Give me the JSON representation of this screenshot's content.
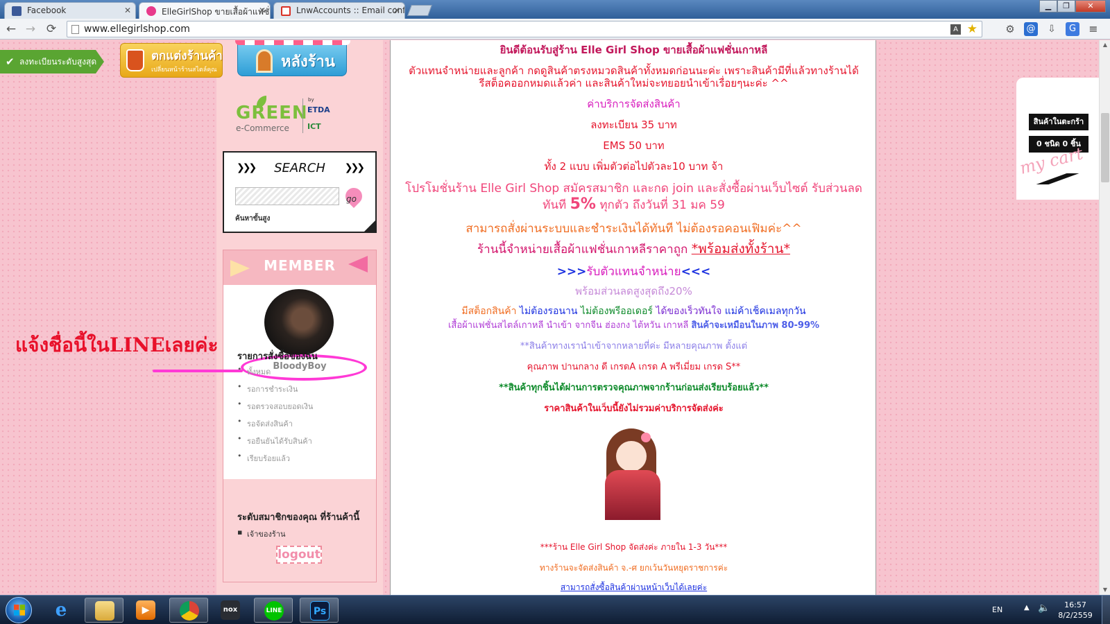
{
  "browser": {
    "tabs": [
      {
        "title": "Facebook",
        "favicon_color": "#3b5998",
        "active": false
      },
      {
        "title": "ElleGirlShop ขายเสื้อผ้าแฟชั่",
        "favicon_color": "#e83a8b",
        "active": true
      },
      {
        "title": "LnwAccounts :: Email conf",
        "favicon_color": "#d93025",
        "active": false
      }
    ],
    "url": "www.ellegirlshop.com",
    "nav": {
      "back": "←",
      "forward": "→",
      "reload": "⟳"
    }
  },
  "header_strip": {
    "level_badge": "ลงทะเบียนระดับสูงสุด",
    "decorate_button": {
      "title": "ตกแต่งร้านค้า",
      "subtitle": "เปลี่ยนหน้าร้านสไตล์คุณ"
    },
    "backstore_button": "หลังร้าน"
  },
  "green_logo": {
    "brand": "GREEN",
    "sub": "e-Commerce",
    "by": "by",
    "org1": "ETDA",
    "org2": "ICT"
  },
  "search": {
    "title": "SEARCH",
    "placeholder": "",
    "go_label": "go",
    "advanced_label": "ค้นหาขั้นสูง"
  },
  "member": {
    "title": "MEMBER",
    "username": "BloodyBoy",
    "orders_heading": "รายการสั่งซื้อของฉัน",
    "orders": [
      "ทั้งหมด",
      "รอการชำระเงิน",
      "รอตรวจสอบยอดเงิน",
      "รอจัดส่งสินค้า",
      "รอยืนยันได้รับสินค้า",
      "เรียบร้อยแล้ว"
    ],
    "level_heading": "ระดับสมาชิกของคุณ ที่ร้านค้านี้",
    "level_value": "เจ้าของร้าน",
    "logout": "logout"
  },
  "annotation": {
    "text": "แจ้งชื่อนี้ในLINEเลยค่ะ",
    "color": "#e8102a",
    "ring_color": "#ff39d6"
  },
  "content": {
    "welcome": "ยินดีต้อนรับสู่ร้าน Elle Girl Shop ขายเสื้อผ้าแฟชั่นเกาหลี",
    "agent_line1": "ตัวแทนจำหน่ายและลูกค้า กดดูสินค้าตรงหมวดสินค้าทั้งหมดก่อนนะค่ะ เพราะสินค้ามีที่แล้วทางร้านได้",
    "agent_line2": "รีสต็อคออกหมดแล้วค่า และสินค้าใหม่จะทยอยนำเข้าเรื่อยๆนะค่ะ ^^",
    "shipping_heading": "ค่าบริการจัดส่งสินค้า",
    "shipping_reg": "ลงทะเบียน 35 บาท",
    "shipping_ems": "EMS 50 บาท",
    "shipping_extra": "ทั้ง 2 แบบ เพิ่มตัวต่อไปตัวละ10 บาท จ้า",
    "promo_line1": "โปรโมชั่นร้าน Elle Girl Shop สมัครสมาชิก และกด join และสั่งซื้อผ่านเว็บไซต์ รับส่วนลด",
    "promo_line2a": "ทันที ",
    "promo_line2b": "5%",
    "promo_line2c": " ทุกตัว ถึงวันที่ 31 มค 59",
    "order_now": "สามารถสั่งผ่านระบบและชำระเงินได้ทันที ไม่ต้องรอคอนเฟิมค่ะ^^",
    "shop_line_a": "ร้านนี้จำหน่ายเสื้อผ้าแฟชั่นเกาหลีราคาถูก ",
    "shop_line_b": "*พร้อมส่งทั้งร้าน*",
    "agent_arrows_l": ">>>",
    "agent_title": "รับตัวแทนจำหน่าย",
    "agent_arrows_r": "<<<",
    "discount": "พร้อมส่วนลดสูงสุดถึง20%",
    "stock_a": "มีสต็อกสินค้า ",
    "stock_b": "ไม่ต้องรอนาน ",
    "stock_c": "ไม่ต้องพรีออเดอร์ ",
    "stock_d": "ได้ของเร็วทันใจ ",
    "stock_e": "แม่ค้าเช็คเมลทุกวัน",
    "import_a": "เสื้อผ้าแฟชั่นสไตล์เกาหลี นำเข้า จากจีน ฮ่องกง ไต้หวัน เกาหลี ",
    "import_b": "สินค้าจะเหมือนในภาพ 80-99%",
    "quality_line": "**สินค้าทางเรานำเข้าจากหลายที่ค่ะ มีหลายคุณภาพ ตั้งแต่",
    "grade_line": "คุณภาพ ปานกลาง ดี เกรดA เกรด A พรีเมี่ยม เกรด S**",
    "checked_line": "**สินค้าทุกชิ้นได้ผ่านการตรวจคุณภาพจากร้านก่อนส่งเรียบร้อยแล้ว**",
    "price_note": "ราคาสินค้าในเว็บนี้ยังไม่รวมค่าบริการจัดส่งค่ะ",
    "ship_time": "***ร้าน Elle Girl Shop จัดส่งค่ะ ภายใน 1-3 วัน***",
    "ship_days": "ทางร้านจะจัดส่งสินค้า จ.-ศ ยกเว้นวันหยุดราชการค่ะ",
    "cut_line": "สามารถสั่งซื้อสินค้าผ่านหน้าเว็บได้เลยค่ะ"
  },
  "cart": {
    "title": "สินค้าในตะกร้า",
    "count": "0 ชนิด 0 ชิ้น",
    "script": "my cart"
  },
  "taskbar": {
    "apps": [
      "ie-icon",
      "explorer-icon",
      "media-player-icon",
      "chrome-icon",
      "nox-icon",
      "line-icon",
      "photoshop-icon"
    ],
    "ps_label": "Ps",
    "nox_label": "nox",
    "line_label": "LINE",
    "ie_label": "e",
    "lang": "EN",
    "time": "16:57",
    "date": "8/2/2559"
  }
}
